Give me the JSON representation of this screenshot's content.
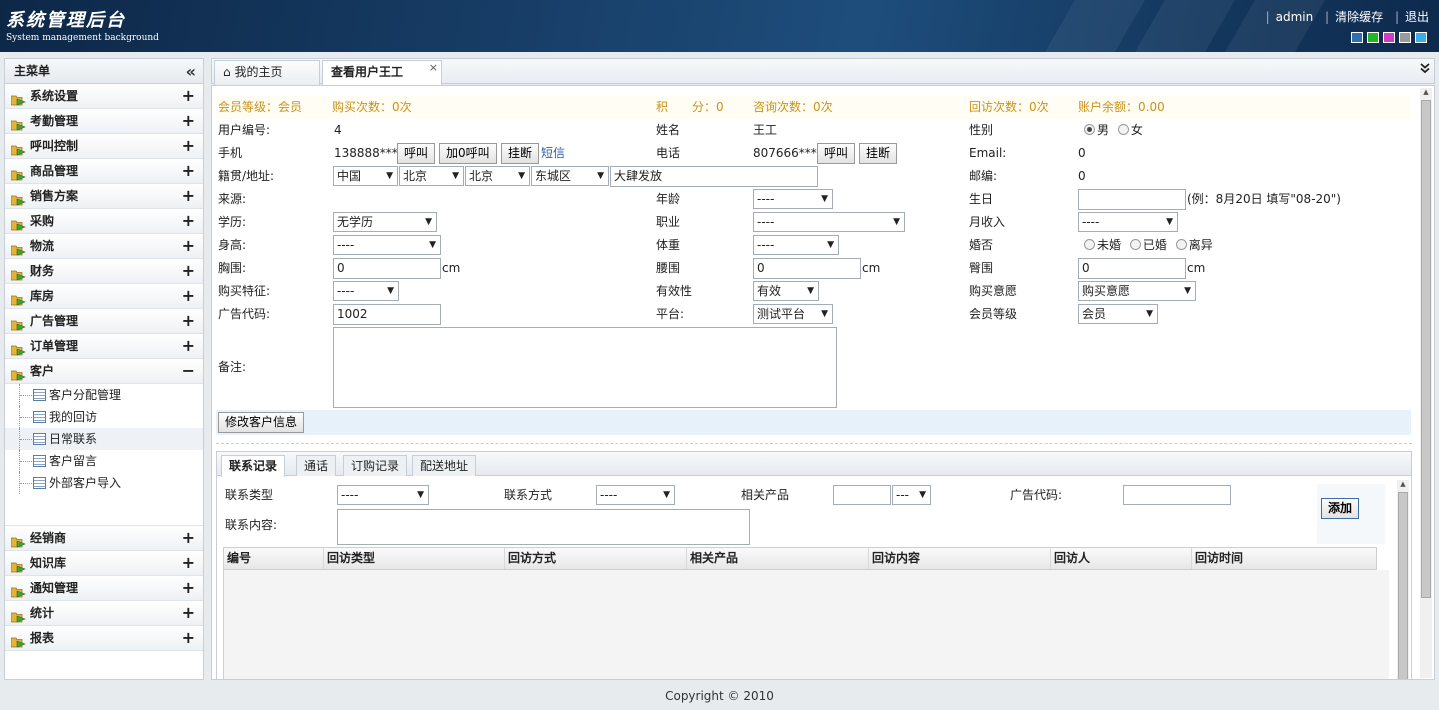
{
  "header": {
    "title": "系统管理后台",
    "subtitle": "System management background",
    "links": [
      "admin",
      "清除缓存",
      "退出"
    ],
    "theme_colors": [
      "#2f6fb3",
      "#22b822",
      "#d23bc6",
      "#9a9a9a",
      "#3aaee6"
    ]
  },
  "sidebar": {
    "title": "主菜单",
    "collapse_icon": "«",
    "items_top": [
      {
        "label": "系统设置",
        "toggle": "+"
      },
      {
        "label": "考勤管理",
        "toggle": "+"
      },
      {
        "label": "呼叫控制",
        "toggle": "+"
      },
      {
        "label": "商品管理",
        "toggle": "+"
      },
      {
        "label": "销售方案",
        "toggle": "+"
      },
      {
        "label": "采购",
        "toggle": "+"
      },
      {
        "label": "物流",
        "toggle": "+"
      },
      {
        "label": "财务",
        "toggle": "+"
      },
      {
        "label": "库房",
        "toggle": "+"
      },
      {
        "label": "广告管理",
        "toggle": "+"
      },
      {
        "label": "订单管理",
        "toggle": "+"
      },
      {
        "label": "客户",
        "toggle": "−"
      }
    ],
    "sub_items": [
      "客户分配管理",
      "我的回访",
      "日常联系",
      "客户留言",
      "外部客户导入"
    ],
    "items_bottom": [
      {
        "label": "经销商",
        "toggle": "+"
      },
      {
        "label": "知识库",
        "toggle": "+"
      },
      {
        "label": "通知管理",
        "toggle": "+"
      },
      {
        "label": "统计",
        "toggle": "+"
      },
      {
        "label": "报表",
        "toggle": "+"
      }
    ]
  },
  "tabs": {
    "home_label": "我的主页",
    "home_icon": "⌂",
    "current_label": "查看用户王工",
    "close": "×",
    "dropdown_icon": "⌄"
  },
  "form": {
    "summary": {
      "level": "会员等级：会员",
      "buy_count": "购买次数：0次",
      "points_label": "积　　分：0",
      "consult": "咨询次数：0次",
      "visit": "回访次数：0次",
      "balance": "账户余额：0.00"
    },
    "user_id_label": "用户编号:",
    "user_id": "4",
    "name_label": "姓名",
    "name": "王工",
    "gender_label": "性别",
    "gender_male": "男",
    "gender_female": "女",
    "mobile_label": "手机",
    "mobile": "138888****",
    "btn_call": "呼叫",
    "btn_call0": "加0呼叫",
    "btn_hangup": "挂断",
    "sms": "短信",
    "phone_label": "电话",
    "phone": "807666****",
    "email_label": "Email:",
    "email": "0",
    "address_label": "籍贯/地址:",
    "addr_country": "中国",
    "addr_province": "北京",
    "addr_city": "北京",
    "addr_district": "东城区",
    "addr_detail": "大肆发放",
    "zip_label": "邮编:",
    "zip": "0",
    "source_label": "来源:",
    "age_label": "年龄",
    "age": "----",
    "birthday_label": "生日",
    "birthday_hint": "(例：8月20日 填写\"08-20\")",
    "edu_label": "学历:",
    "edu": "无学历",
    "job_label": "职业",
    "job": "----",
    "income_label": "月收入",
    "income": "----",
    "height_label": "身高:",
    "height": "----",
    "weight_label": "体重",
    "weight": "----",
    "marital_label": "婚否",
    "marital_opts": [
      "未婚",
      "已婚",
      "离异"
    ],
    "chest_label": "胸围:",
    "chest": "0",
    "unit_cm": "cm",
    "waist_label": "腰围",
    "waist": "0",
    "hip_label": "臀围",
    "hip": "0",
    "feature_label": "购买特征:",
    "feature": "----",
    "valid_label": "有效性",
    "valid": "有效",
    "intent_label": "购买意愿",
    "intent": "购买意愿",
    "ad_label": "广告代码:",
    "ad": "1002",
    "platform_label": "平台:",
    "platform": "测试平台",
    "member_label": "会员等级",
    "member": "会员",
    "note_label": "备注:",
    "submit": "修改客户信息"
  },
  "subpanel": {
    "tabs": [
      "联系记录",
      "通话",
      "订购记录",
      "配送地址"
    ],
    "contact_type_label": "联系类型",
    "contact_type": "----",
    "contact_way_label": "联系方式",
    "contact_way": "----",
    "product_label": "相关产品",
    "product_sel": "---",
    "ad_label": "广告代码:",
    "content_label": "联系内容:",
    "add_btn": "添加",
    "columns": [
      "编号",
      "回访类型",
      "回访方式",
      "相关产品",
      "回访内容",
      "回访人",
      "回访时间"
    ]
  },
  "footer": "Copyright © 2010"
}
